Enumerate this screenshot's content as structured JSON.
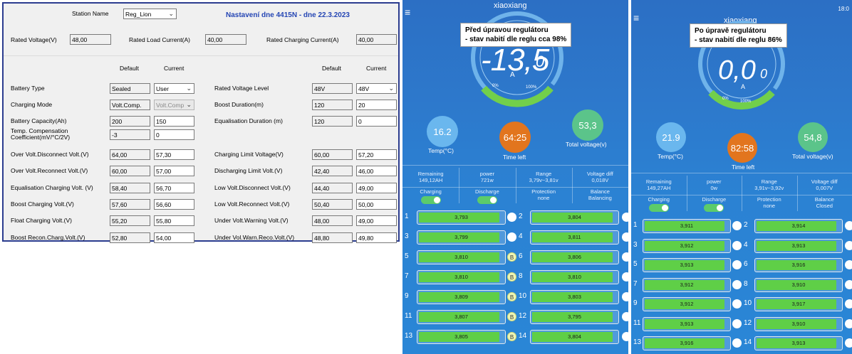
{
  "panel": {
    "title": "Nastavení dne 4415N - dne 22.3.2023",
    "station_label": "Station Name",
    "station_value": "Reg_Lion",
    "rated_voltage_label": "Rated Voltage(V)",
    "rated_voltage_value": "48,00",
    "rated_load_label": "Rated Load Current(A)",
    "rated_load_value": "40,00",
    "rated_charging_label": "Rated Charging Current(A)",
    "rated_charging_value": "40,00",
    "hdr_default": "Default",
    "hdr_current": "Current",
    "left_rows": [
      {
        "label": "Battery Type",
        "default": "Sealed",
        "current": "User",
        "type": "select"
      },
      {
        "label": "Charging Mode",
        "default": "Volt.Comp.",
        "current": "Volt.Comp",
        "type": "select-disabled"
      },
      {
        "label": "Battery Capacity(Ah)",
        "default": "200",
        "current": "150",
        "type": "input"
      },
      {
        "label": "Temp. Compensation",
        "label2": "Coefficient(mV/°C/2V)",
        "default": "-3",
        "current": "0",
        "type": "input"
      },
      {
        "label": "Over Volt.Disconnect Volt.(V)",
        "default": "64,00",
        "current": "57,30",
        "type": "input"
      },
      {
        "label": "Over Volt.Reconnect Volt.(V)",
        "default": "60,00",
        "current": "57,00",
        "type": "input"
      },
      {
        "label": "Equalisation Charging Volt. (V)",
        "default": "58,40",
        "current": "56,70",
        "type": "input"
      },
      {
        "label": "Boost Charging Volt.(V)",
        "default": "57,60",
        "current": "56,60",
        "type": "input"
      },
      {
        "label": "Float Charging Volt.(V)",
        "default": "55,20",
        "current": "55,80",
        "type": "input"
      },
      {
        "label": "Boost Recon.Charg.Volt.(V)",
        "default": "52,80",
        "current": "54,00",
        "type": "input"
      }
    ],
    "right_rows": [
      {
        "label": "Rated Voltage Level",
        "default": "48V",
        "current": "48V",
        "type": "select"
      },
      {
        "label": "Boost Duration(m)",
        "default": "120",
        "current": "20",
        "type": "input"
      },
      {
        "label": "Equalisation Duration (m)",
        "default": "120",
        "current": "0",
        "type": "input"
      },
      {
        "label": "Charging Limit Voltage(V)",
        "default": "60,00",
        "current": "57,20",
        "type": "input"
      },
      {
        "label": "Discharging Limit Volt.(V)",
        "default": "42,40",
        "current": "46,00",
        "type": "input"
      },
      {
        "label": "Low Volt.Disconnect Volt.(V)",
        "default": "44,40",
        "current": "49,00",
        "type": "input"
      },
      {
        "label": "Low Volt.Reconnect Volt.(V)",
        "default": "50,40",
        "current": "50,00",
        "type": "input"
      },
      {
        "label": "Under Volt.Warning Volt.(V)",
        "default": "48,00",
        "current": "49,00",
        "type": "input"
      },
      {
        "label": "Under Vol.Warn.Reco.Volt.(V)",
        "default": "48,80",
        "current": "49,80",
        "type": "input"
      }
    ]
  },
  "phones": [
    {
      "app_name": "xiaoxiang",
      "caption_line1": "Před úpravou regulátoru",
      "caption_line2": "- stav nabití dle reglu cca 98%",
      "current": "-13,5",
      "current_dec": "0",
      "unit": "A",
      "gauge_pct": "0%",
      "gauge_pct2": "100%",
      "temp": "16.2",
      "temp_label": "Temp(°C)",
      "time": "64:25",
      "time_label": "Time left",
      "voltage": "53,3",
      "voltage_label": "Total voltage(v)",
      "remaining_label": "Remaining",
      "remaining": "149,12AH",
      "power_label": "power",
      "power": "721w",
      "range_label": "Range",
      "range": "3,79v~3,81v",
      "vdiff_label": "Voltage diff",
      "vdiff": "0,018V",
      "charging_label": "Charging",
      "discharge_label": "Discharge",
      "protection_label": "Protection",
      "protection": "none",
      "balance_label": "Balance",
      "balance": "Balancing",
      "cells": [
        "3,793",
        "3,804",
        "3,799",
        "3,811",
        "3,810",
        "3,806",
        "3,810",
        "3,810",
        "3,809",
        "3,803",
        "3,807",
        "3,795",
        "3,805",
        "3,804"
      ],
      "balancing_cells": [
        5,
        7,
        9,
        11,
        13
      ]
    },
    {
      "app_name": "xiaoxiang",
      "status_time": "18:0",
      "caption_line1": "Po úpravě regulátoru",
      "caption_line2": "- stav nabití dle reglu 86%",
      "current": "0,0",
      "current_dec": "0",
      "unit": "A",
      "gauge_pct": "0%",
      "gauge_pct2": "100%",
      "temp": "21.9",
      "temp_label": "Temp(°C)",
      "time": "82:58",
      "time_label": "Time left",
      "voltage": "54,8",
      "voltage_label": "Total voltage(v)",
      "remaining_label": "Remaining",
      "remaining": "149,27AH",
      "power_label": "power",
      "power": "0w",
      "range_label": "Range",
      "range": "3,91v~3,92v",
      "vdiff_label": "Voltage diff",
      "vdiff": "0,007V",
      "charging_label": "Charging",
      "discharge_label": "Discharge",
      "protection_label": "Protection",
      "protection": "none",
      "balance_label": "Balance",
      "balance": "Closed",
      "cells": [
        "3,911",
        "3,914",
        "3,912",
        "3,913",
        "3,913",
        "3,916",
        "3,912",
        "3,910",
        "3,912",
        "3,917",
        "3,913",
        "3,910",
        "3,916",
        "3,913"
      ],
      "balancing_cells": []
    }
  ],
  "colors": {
    "accent_blue": "#2546b4",
    "cell_green": "#5fcf47",
    "time_orange": "#e2751e"
  }
}
